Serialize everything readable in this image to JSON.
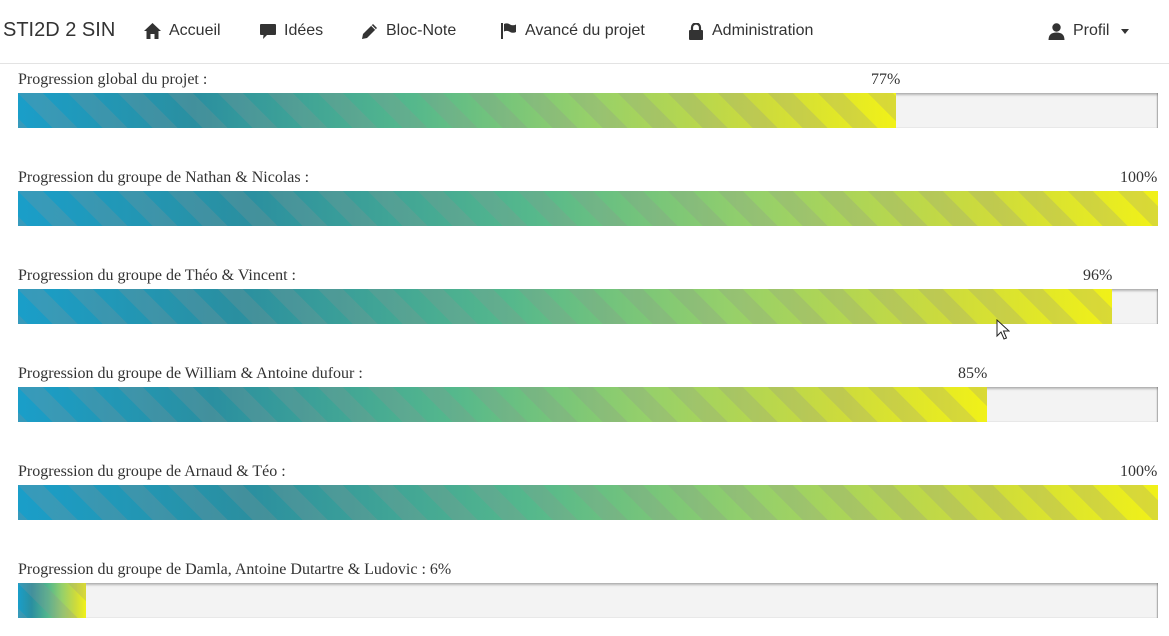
{
  "navbar": {
    "brand": "STI2D 2 SIN",
    "items": [
      {
        "label": "Accueil",
        "icon": "home-icon"
      },
      {
        "label": "Idées",
        "icon": "comment-icon"
      },
      {
        "label": "Bloc-Note",
        "icon": "pencil-icon"
      },
      {
        "label": "Avancé du projet",
        "icon": "flag-icon"
      },
      {
        "label": "Administration",
        "icon": "lock-icon"
      }
    ],
    "profile": {
      "label": "Profil",
      "icon": "user-icon"
    }
  },
  "progress": [
    {
      "label": "Progression global du projet :",
      "percent_text": "77%",
      "value": 77
    },
    {
      "label": "Progression du groupe de Nathan & Nicolas :",
      "percent_text": "100%",
      "value": 100
    },
    {
      "label": "Progression du groupe de Théo & Vincent :",
      "percent_text": "96%",
      "value": 96
    },
    {
      "label": "Progression du groupe de William & Antoine dufour :",
      "percent_text": "85%",
      "value": 85
    },
    {
      "label": "Progression du groupe de Arnaud & Téo :",
      "percent_text": "100%",
      "value": 100
    },
    {
      "label": "Progression du groupe de Damla, Antoine Dutartre & Ludovic :",
      "percent_text": "6%",
      "value": 6
    }
  ],
  "colors": {
    "gradient_start": "#1a9ec9",
    "gradient_end": "#f1f118",
    "track": "#f3f3f3",
    "text": "#333333"
  }
}
